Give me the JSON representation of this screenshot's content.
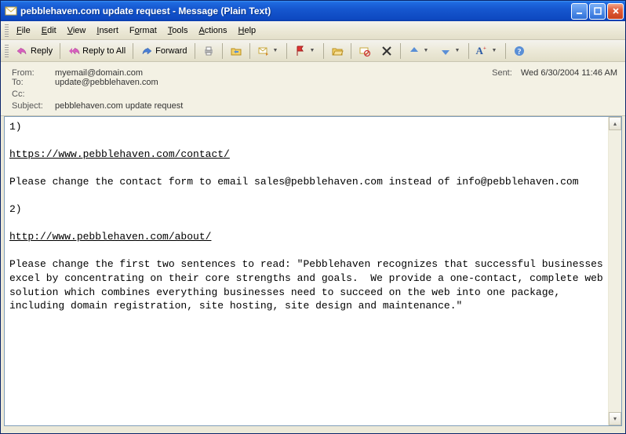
{
  "window": {
    "title": "pebblehaven.com update request - Message (Plain Text)"
  },
  "menu": {
    "file": "File",
    "edit": "Edit",
    "view": "View",
    "insert": "Insert",
    "format": "Format",
    "tools": "Tools",
    "actions": "Actions",
    "help": "Help"
  },
  "toolbar": {
    "reply": "Reply",
    "reply_all": "Reply to All",
    "forward": "Forward"
  },
  "headers": {
    "from_label": "From:",
    "from": "myemail@domain.com",
    "sent_label": "Sent:",
    "sent": "Wed 6/30/2004 11:46 AM",
    "to_label": "To:",
    "to": "update@pebblehaven.com",
    "cc_label": "Cc:",
    "cc": "",
    "subject_label": "Subject:",
    "subject": "pebblehaven.com update request"
  },
  "body": {
    "line1": "1)",
    "url1": "https://www.pebblehaven.com/contact/",
    "para1": "Please change the contact form to email sales@pebblehaven.com instead of info@pebblehaven.com",
    "line2": "2)",
    "url2": "http://www.pebblehaven.com/about/",
    "para2": "Please change the first two sentences to read: \"Pebblehaven recognizes that successful businesses excel by concentrating on their core strengths and goals.  We provide a one-contact, complete web solution which combines everything businesses need to succeed on the web into one package, including domain registration, site hosting, site design and maintenance.\""
  },
  "colors": {
    "titlebar_start": "#3b91f3",
    "titlebar_end": "#0a3caa",
    "chrome_bg": "#ece9d8"
  }
}
